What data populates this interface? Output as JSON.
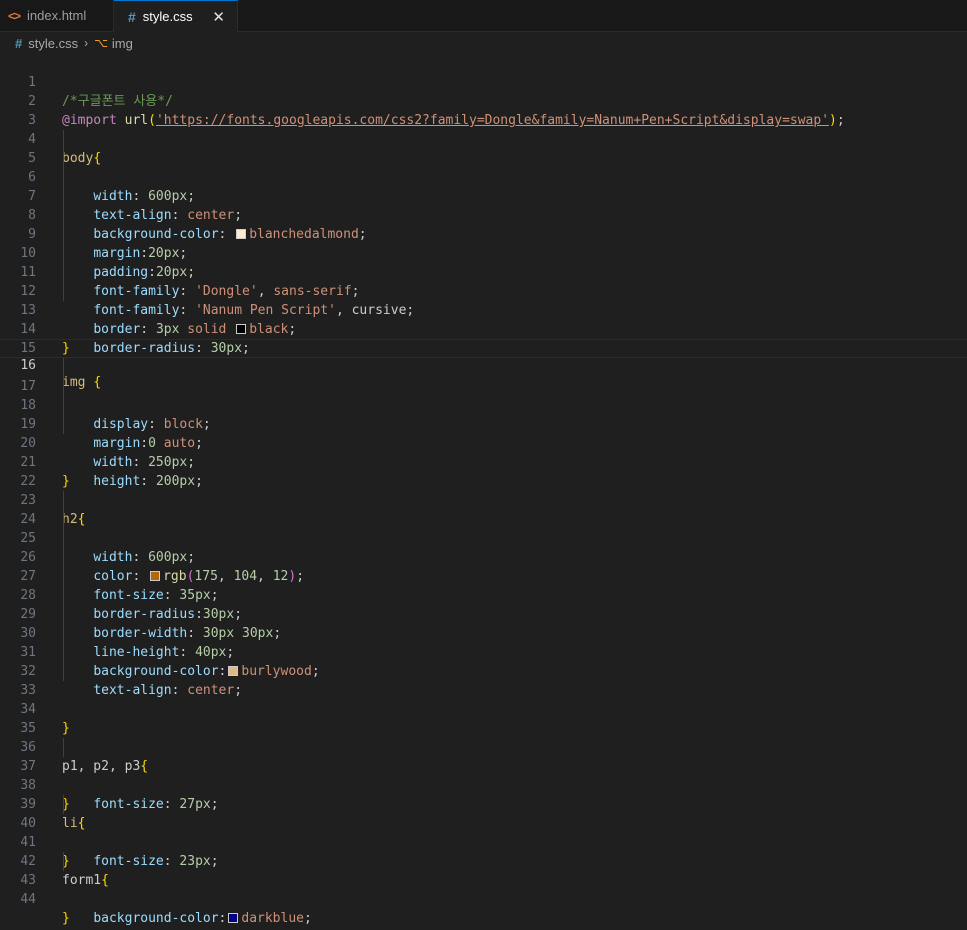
{
  "tabs": [
    {
      "label": "index.html",
      "icon": "html-file-icon",
      "active": false
    },
    {
      "label": "style.css",
      "icon": "css-file-icon",
      "active": true
    }
  ],
  "close_glyph": "✕",
  "breadcrumb": {
    "file": "style.css",
    "symbol": "img"
  },
  "lines": {
    "l1": {
      "num": "1",
      "t": [
        "/*구글폰트 사용*/"
      ]
    },
    "l2": {
      "num": "2",
      "t": [
        "@import",
        " ",
        "url",
        "(",
        "'https://fonts.googleapis.com/css2?family=Dongle&family=Nanum+Pen+Script&display=swap'",
        ")",
        ";"
      ]
    },
    "l3": {
      "num": "3"
    },
    "l4": {
      "num": "4",
      "t": [
        "body",
        "{"
      ]
    },
    "l5": {
      "num": "5",
      "t": [
        "width",
        ": ",
        "600px",
        ";"
      ]
    },
    "l6": {
      "num": "6",
      "t": [
        "text-align",
        ": ",
        "center",
        ";"
      ]
    },
    "l7": {
      "num": "7",
      "t": [
        "background-color",
        ": ",
        "blanchedalmond",
        ";"
      ],
      "swatch": "#ffebcd"
    },
    "l8": {
      "num": "8",
      "t": [
        "margin",
        ":",
        "20px",
        ";"
      ]
    },
    "l9": {
      "num": "9",
      "t": [
        "padding",
        ":",
        "20px",
        ";"
      ]
    },
    "l10": {
      "num": "10",
      "t": [
        "font-family",
        ": ",
        "'Dongle'",
        ", ",
        "sans-serif",
        ";"
      ]
    },
    "l11": {
      "num": "11",
      "t": [
        "font-family",
        ": ",
        "'Nanum Pen Script'",
        ", ",
        "cursive",
        ";"
      ]
    },
    "l12": {
      "num": "12",
      "t": [
        "border",
        ": ",
        "3px",
        " ",
        "solid",
        " ",
        "black",
        ";"
      ],
      "swatch": "#000000"
    },
    "l13": {
      "num": "13",
      "t": [
        "border-radius",
        ": ",
        "30px",
        ";"
      ]
    },
    "l14": {
      "num": "14",
      "t": [
        "}"
      ]
    },
    "l15": {
      "num": "15"
    },
    "l16": {
      "num": "16",
      "t": [
        "img",
        " ",
        "{"
      ]
    },
    "l17": {
      "num": "17",
      "t": [
        "display",
        ": ",
        "block",
        ";"
      ]
    },
    "l18": {
      "num": "18",
      "t": [
        "margin",
        ":",
        "0",
        " ",
        "auto",
        ";"
      ]
    },
    "l19": {
      "num": "19",
      "t": [
        "width",
        ": ",
        "250px",
        ";"
      ]
    },
    "l20": {
      "num": "20",
      "t": [
        "height",
        ": ",
        "200px",
        ";"
      ]
    },
    "l21": {
      "num": "21",
      "t": [
        "}"
      ]
    },
    "l22": {
      "num": "22"
    },
    "l23": {
      "num": "23",
      "t": [
        "h2",
        "{"
      ]
    },
    "l24": {
      "num": "24",
      "t": [
        "width",
        ": ",
        "600px",
        ";"
      ]
    },
    "l25": {
      "num": "25",
      "t": [
        "color",
        ": ",
        "rgb",
        "(",
        "175",
        ", ",
        "104",
        ", ",
        "12",
        ")",
        ";"
      ],
      "swatch": "#af680c"
    },
    "l26": {
      "num": "26",
      "t": [
        "font-size",
        ": ",
        "35px",
        ";"
      ]
    },
    "l27": {
      "num": "27",
      "t": [
        "border-radius",
        ":",
        "30px",
        ";"
      ]
    },
    "l28": {
      "num": "28",
      "t": [
        "border-width",
        ": ",
        "30px",
        " ",
        "30px",
        ";"
      ]
    },
    "l29": {
      "num": "29",
      "t": [
        "line-height",
        ": ",
        "40px",
        ";"
      ]
    },
    "l30": {
      "num": "30",
      "t": [
        "background-color",
        ":",
        "burlywood",
        ";"
      ],
      "swatch": "#deb887"
    },
    "l31": {
      "num": "31",
      "t": [
        "text-align",
        ": ",
        "center",
        ";"
      ]
    },
    "l32": {
      "num": "32"
    },
    "l33": {
      "num": "33"
    },
    "l34": {
      "num": "34",
      "t": [
        "}"
      ]
    },
    "l35": {
      "num": "35"
    },
    "l36": {
      "num": "36",
      "t": [
        "p1, p2, p3",
        "{"
      ]
    },
    "l37": {
      "num": "37",
      "t": [
        "font-size",
        ": ",
        "27px",
        ";"
      ]
    },
    "l38": {
      "num": "38",
      "t": [
        "}"
      ]
    },
    "l39": {
      "num": "39",
      "t": [
        "li",
        "{"
      ]
    },
    "l40": {
      "num": "40",
      "t": [
        "font-size",
        ": ",
        "23px",
        ";"
      ]
    },
    "l41": {
      "num": "41",
      "t": [
        "}"
      ]
    },
    "l42": {
      "num": "42",
      "t": [
        "form1",
        "{"
      ]
    },
    "l43": {
      "num": "43",
      "t": [
        "background-color",
        ":",
        "darkblue",
        ";"
      ],
      "swatch": "#00008b"
    },
    "l44": {
      "num": "44",
      "t": [
        "}"
      ]
    }
  },
  "active_line": "16",
  "colors": {
    "editor_bg": "#1f1f1f",
    "comment": "#6a9955",
    "string": "#ce9178",
    "property": "#9cdcfe",
    "number": "#b5cea8",
    "selector": "#d7ba7d",
    "bracket": "#ffd700"
  }
}
